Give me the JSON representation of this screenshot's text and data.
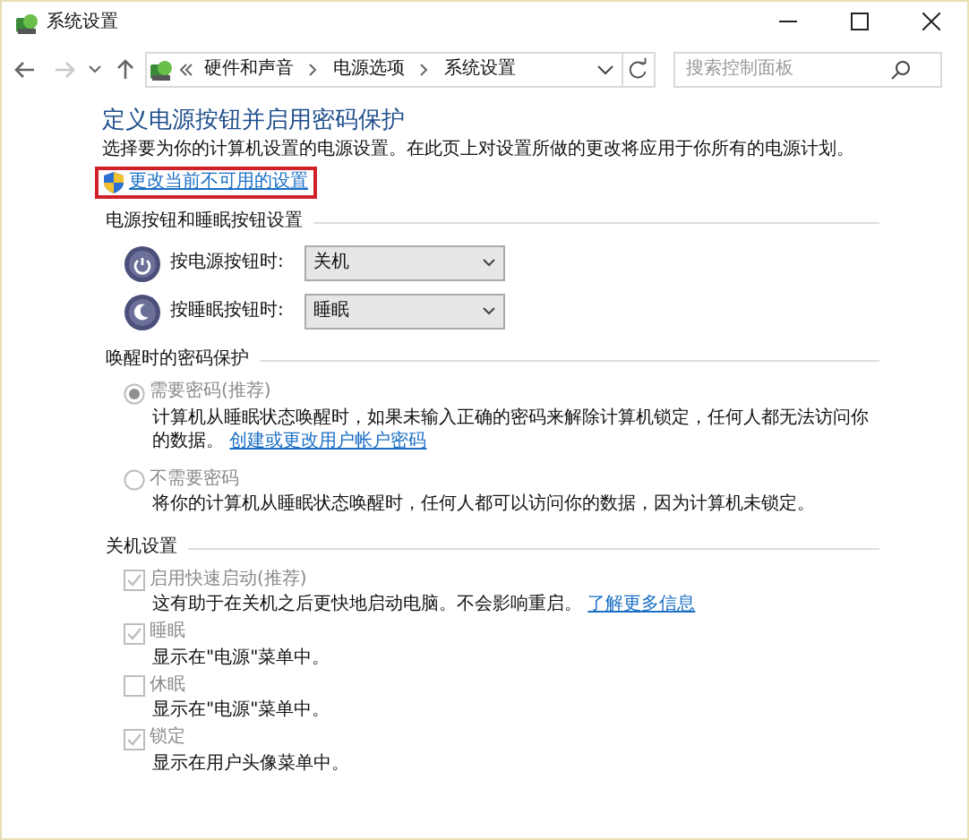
{
  "window": {
    "title": "系统设置"
  },
  "nav": {
    "back_disabled": false,
    "forward_disabled": true
  },
  "breadcrumb": [
    "硬件和声音",
    "电源选项",
    "系统设置"
  ],
  "search": {
    "placeholder": "搜索控制面板"
  },
  "heading": "定义电源按钮并启用密码保护",
  "description": "选择要为你的计算机设置的电源设置。在此页上对设置所做的更改将应用于你所有的电源计划。",
  "admin_link": {
    "text": "更改当前不可用的设置",
    "highlighted": true
  },
  "sections": [
    {
      "title": "电源按钮和睡眠按钮设置",
      "kind": "selects",
      "rows": [
        {
          "label": "按电源按钮时:",
          "value": "关机"
        },
        {
          "label": "按睡眠按钮时:",
          "value": "睡眠"
        }
      ]
    },
    {
      "title": "唤醒时的密码保护",
      "kind": "radios",
      "options": [
        {
          "label": "需要密码(推荐)",
          "selected": true,
          "disabled": true,
          "description": "计算机从睡眠状态唤醒时，如果未输入正确的密码来解除计算机锁定，任何人都无法访问你的数据。",
          "link": "创建或更改用户帐户密码"
        },
        {
          "label": "不需要密码",
          "selected": false,
          "disabled": true,
          "description": "将你的计算机从睡眠状态唤醒时，任何人都可以访问你的数据，因为计算机未锁定。"
        }
      ]
    },
    {
      "title": "关机设置",
      "kind": "checkboxes",
      "options": [
        {
          "label": "启用快速启动(推荐)",
          "checked": true,
          "disabled": true,
          "description": "这有助于在关机之后更快地启动电脑。不会影响重启。",
          "link": "了解更多信息"
        },
        {
          "label": "睡眠",
          "checked": true,
          "disabled": true,
          "description": "显示在\"电源\"菜单中。"
        },
        {
          "label": "休眠",
          "checked": false,
          "disabled": true,
          "description": "显示在\"电源\"菜单中。"
        },
        {
          "label": "锁定",
          "checked": true,
          "disabled": true,
          "description": "显示在用户头像菜单中。"
        }
      ]
    }
  ]
}
